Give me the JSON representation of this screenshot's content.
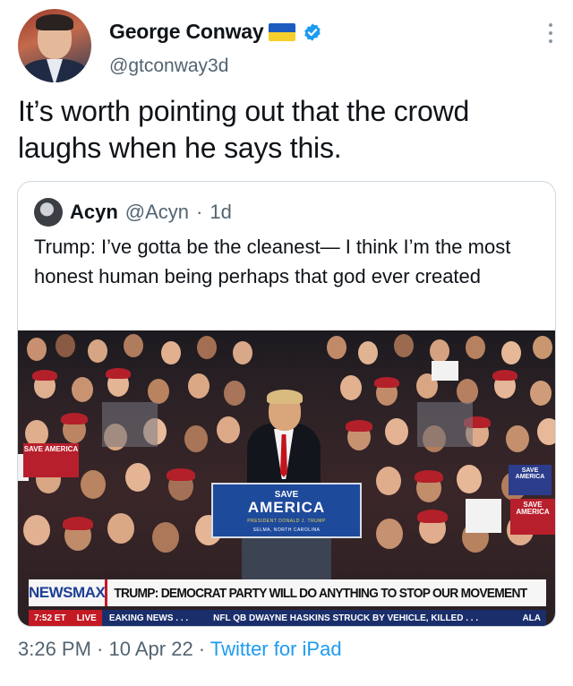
{
  "author": {
    "name": "George Conway",
    "handle": "@gtconway3d",
    "flag": "ukraine-flag",
    "verified": true
  },
  "tweet": {
    "text": "It’s worth pointing out that the crowd laughs when he says this."
  },
  "quoted": {
    "name": "Acyn",
    "handle": "@Acyn",
    "separator": "·",
    "time": "1d",
    "text": "Trump: I’ve gotta be the cleanest— I think I’m the most honest human being perhaps that god ever created"
  },
  "media": {
    "podium": {
      "line1": "SAVE",
      "line2": "AMERICA",
      "line3": "PRESIDENT DONALD J. TRUMP",
      "line4": "SELMA, NORTH CAROLINA"
    },
    "signs": [
      "SAVE AMERICA",
      "SAVE AMERICA",
      "SAVE AMERICA"
    ],
    "ticker": {
      "brand": "NEWSMAX",
      "headline": "TRUMP: DEMOCRAT PARTY WILL DO ANYTHING TO STOP OUR MOVEMENT",
      "time": "7:52 ET",
      "live": "LIVE",
      "breaking": "EAKING NEWS . . .",
      "news": "NFL QB DWAYNE HASKINS STRUCK BY VEHICLE, KILLED . . .",
      "overflow": "ALA"
    }
  },
  "footer": {
    "time": "3:26 PM",
    "sep1": " · ",
    "date": "10 Apr 22",
    "sep2": " · ",
    "source": "Twitter for iPad"
  },
  "colors": {
    "link": "#1d9bf0",
    "secondary_text": "#536471",
    "verified": "#1d9bf0",
    "newsmax_blue": "#1c3f94",
    "newsmax_red": "#c41a24"
  }
}
